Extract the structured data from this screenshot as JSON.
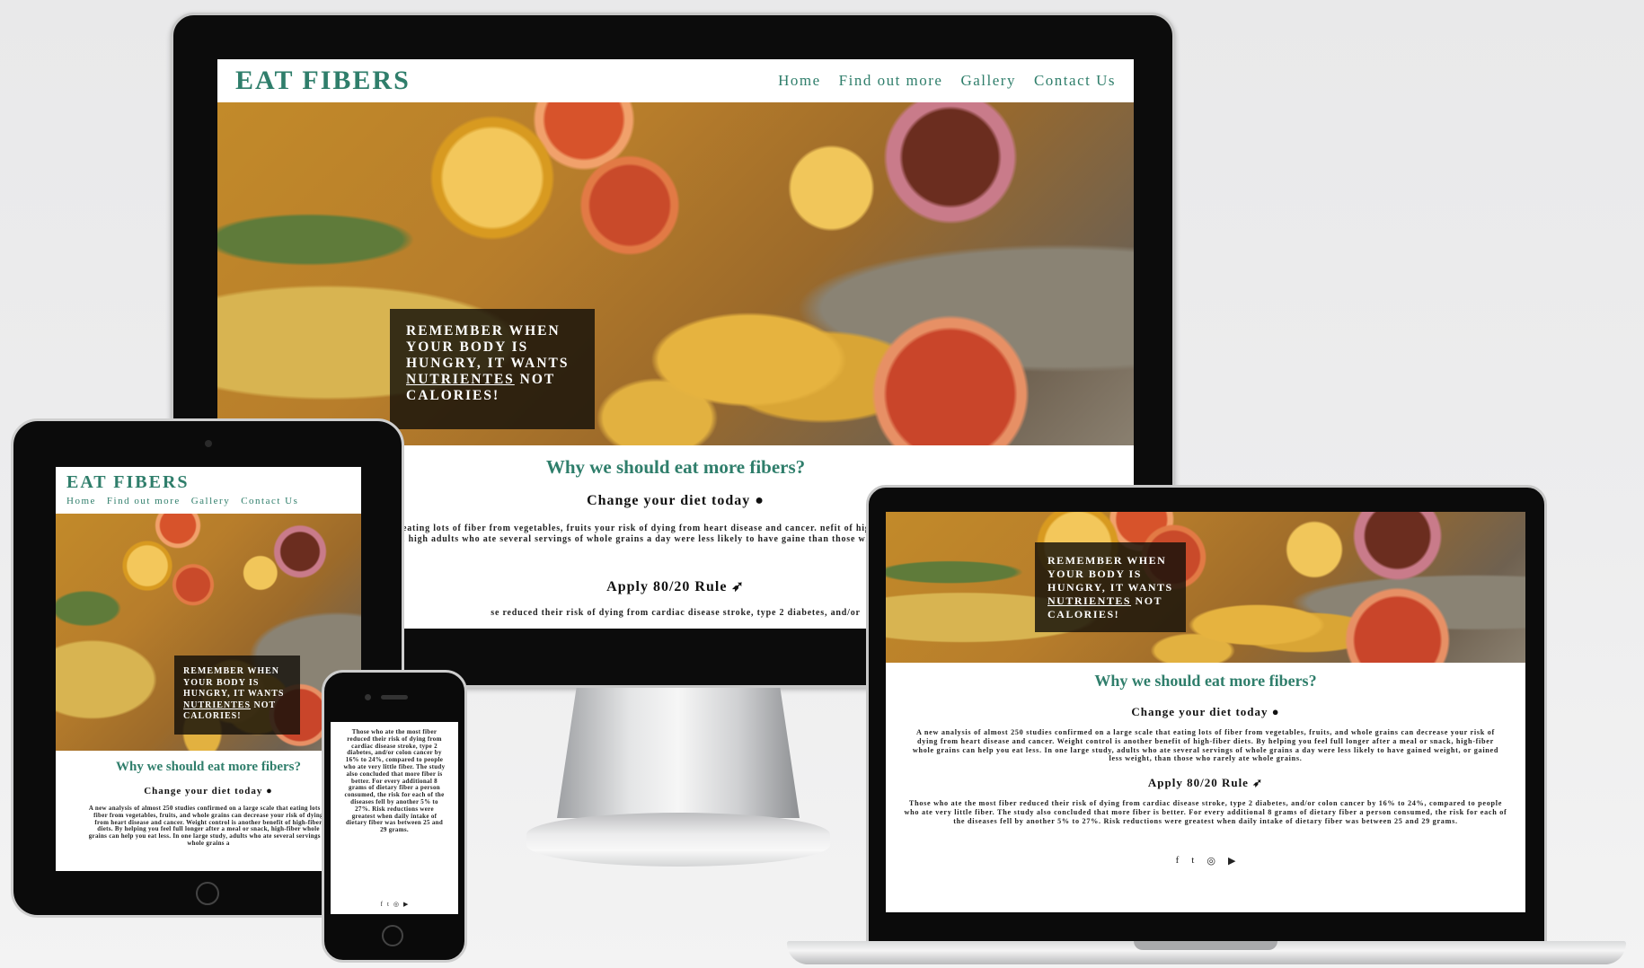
{
  "site": {
    "logo": "EAT FIBERS",
    "nav": [
      "Home",
      "Find out more",
      "Gallery",
      "Contact Us"
    ],
    "hero": {
      "line1": "Remember when",
      "line2": "your body is",
      "line3": "hungry, it wants",
      "highlight": "nutrientes",
      "line4_rest": " not",
      "line5": "calories!"
    },
    "section_title": "Why we should eat more fibers?",
    "diet": {
      "title": "Change your diet today",
      "icon": "apple-icon",
      "text_desktop": "studies confirmed on a large scale that eating lots of fiber from vegetables, fruits your risk of dying from heart disease and cancer. nefit of high-fiber diets. By helping you feel full longer after a meal or snack, high adults who ate several servings of whole grains a day were less likely to have gaine than those who rarely ate whole grains.",
      "text_laptop": "A new analysis of almost 250 studies confirmed on a large scale that eating lots of fiber from vegetables, fruits, and whole grains can decrease your risk of dying from heart disease and cancer. Weight control is another benefit of high-fiber diets. By helping you feel full longer after a meal or snack, high-fiber whole grains can help you eat less. In one large study, adults who ate several servings of whole grains a day were less likely to have gained weight, or gained less weight, than those who rarely ate whole grains.",
      "text_tablet": "A new analysis of almost 250 studies confirmed on a large scale that eating lots of fiber from vegetables, fruits, and whole grains can decrease your risk of dying from heart disease and cancer. Weight control is another benefit of high-fiber diets. By helping you feel full longer after a meal or snack, high-fiber whole grains can help you eat less. In one large study, adults who ate several servings of whole grains a"
    },
    "rule": {
      "title": "Apply 80/20 Rule",
      "icon": "carrot-icon",
      "text_laptop": "Those who ate the most fiber reduced their risk of dying from cardiac disease stroke, type 2 diabetes, and/or colon cancer by 16% to 24%, compared to people who ate very little fiber. The study also concluded that more fiber is better. For every additional 8 grams of dietary fiber a person consumed, the risk for each of the diseases fell by another 5% to 27%. Risk reductions were greatest when daily intake of dietary fiber was between 25 and 29 grams.",
      "text_phone": "Those who ate the most fiber reduced their risk of dying from cardiac disease stroke, type 2 diabetes, and/or colon cancer by 16% to 24%, compared to people who ate very little fiber. The study also concluded that more fiber is better. For every additional 8 grams of dietary fiber a person consumed, the risk for each of the diseases fell by another 5% to 27%. Risk reductions were greatest when daily intake of dietary fiber was between 25 and 29 grams.",
      "text_desktop_cut": "se reduced their risk of dying from cardiac disease stroke, type 2 diabetes, and/or"
    },
    "socials": [
      {
        "name": "facebook-icon",
        "glyph": "f"
      },
      {
        "name": "twitter-icon",
        "glyph": "t"
      },
      {
        "name": "instagram-icon",
        "glyph": "◎"
      },
      {
        "name": "youtube-icon",
        "glyph": "▶"
      }
    ]
  },
  "colors": {
    "brand": "#2f7e6b",
    "hero_box": "#14100a",
    "bezel": "#0c0c0c"
  }
}
